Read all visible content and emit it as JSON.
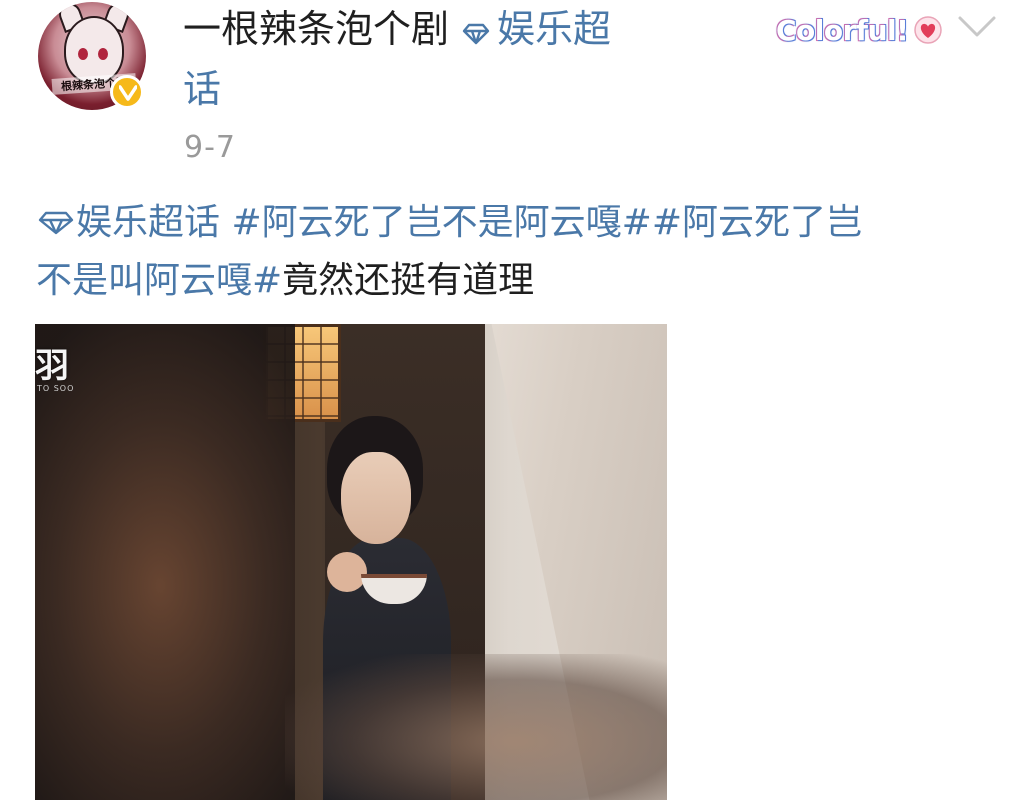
{
  "post": {
    "author": {
      "name": "一根辣条泡个剧",
      "topic_label_part1": "娱乐超",
      "topic_label_part2": "话",
      "avatar_caption": "根辣条泡个剧",
      "verified": true
    },
    "date": "9-7",
    "brand_badge": "Colorful!",
    "body": {
      "topic_prefix": "娱乐超话",
      "hashtag1": "#阿云死了岂不是阿云嘎#",
      "hashtag2_line1": "#阿云死了岂",
      "hashtag2_line2": "不是叫阿云嘎#",
      "trailing_text": "竟然还挺有道理"
    },
    "image": {
      "watermark": "羽",
      "watermark_sub": "TO SOO"
    }
  },
  "colors": {
    "link_blue": "#4a78a8",
    "text_dark": "#1f1f1f",
    "date_gray": "#9a9a9a",
    "verify_gold": "#f6b91a"
  },
  "icons": {
    "topic_icon": "diamond-gem-icon",
    "verify_icon": "verified-v-icon",
    "dropdown_icon": "chevron-down-icon",
    "heart_icon": "heart-icon"
  }
}
